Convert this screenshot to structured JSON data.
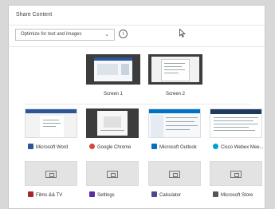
{
  "window": {
    "title": "Share Content"
  },
  "toolbar": {
    "dropdown_value": "Optimize for text and images",
    "dropdown_icon": "chevron-down-icon",
    "info_icon": "info-icon",
    "info_glyph": "i"
  },
  "screens": [
    {
      "label": "Screen 1"
    },
    {
      "label": "Screen 2"
    }
  ],
  "apps": [
    {
      "label": "Microsoft Word",
      "icon": "word-icon",
      "color": "#2b579a"
    },
    {
      "label": "Google Chrome",
      "icon": "chrome-icon",
      "color": "#db4437"
    },
    {
      "label": "Microsoft Outlook",
      "icon": "outlook-icon",
      "color": "#0072c6"
    },
    {
      "label": "Cisco Webex Mee...",
      "icon": "webex-icon",
      "color": "#00a0d1"
    }
  ],
  "apps_minimized": [
    {
      "label": "Films && TV",
      "icon": "films-tv-icon",
      "color": "#a4262c"
    },
    {
      "label": "Settings",
      "icon": "settings-icon",
      "color": "#5b2ca0"
    },
    {
      "label": "Calculator",
      "icon": "calculator-icon",
      "color": "#4a4a8a"
    },
    {
      "label": "Microsoft Store",
      "icon": "store-icon",
      "color": "#555555"
    }
  ]
}
